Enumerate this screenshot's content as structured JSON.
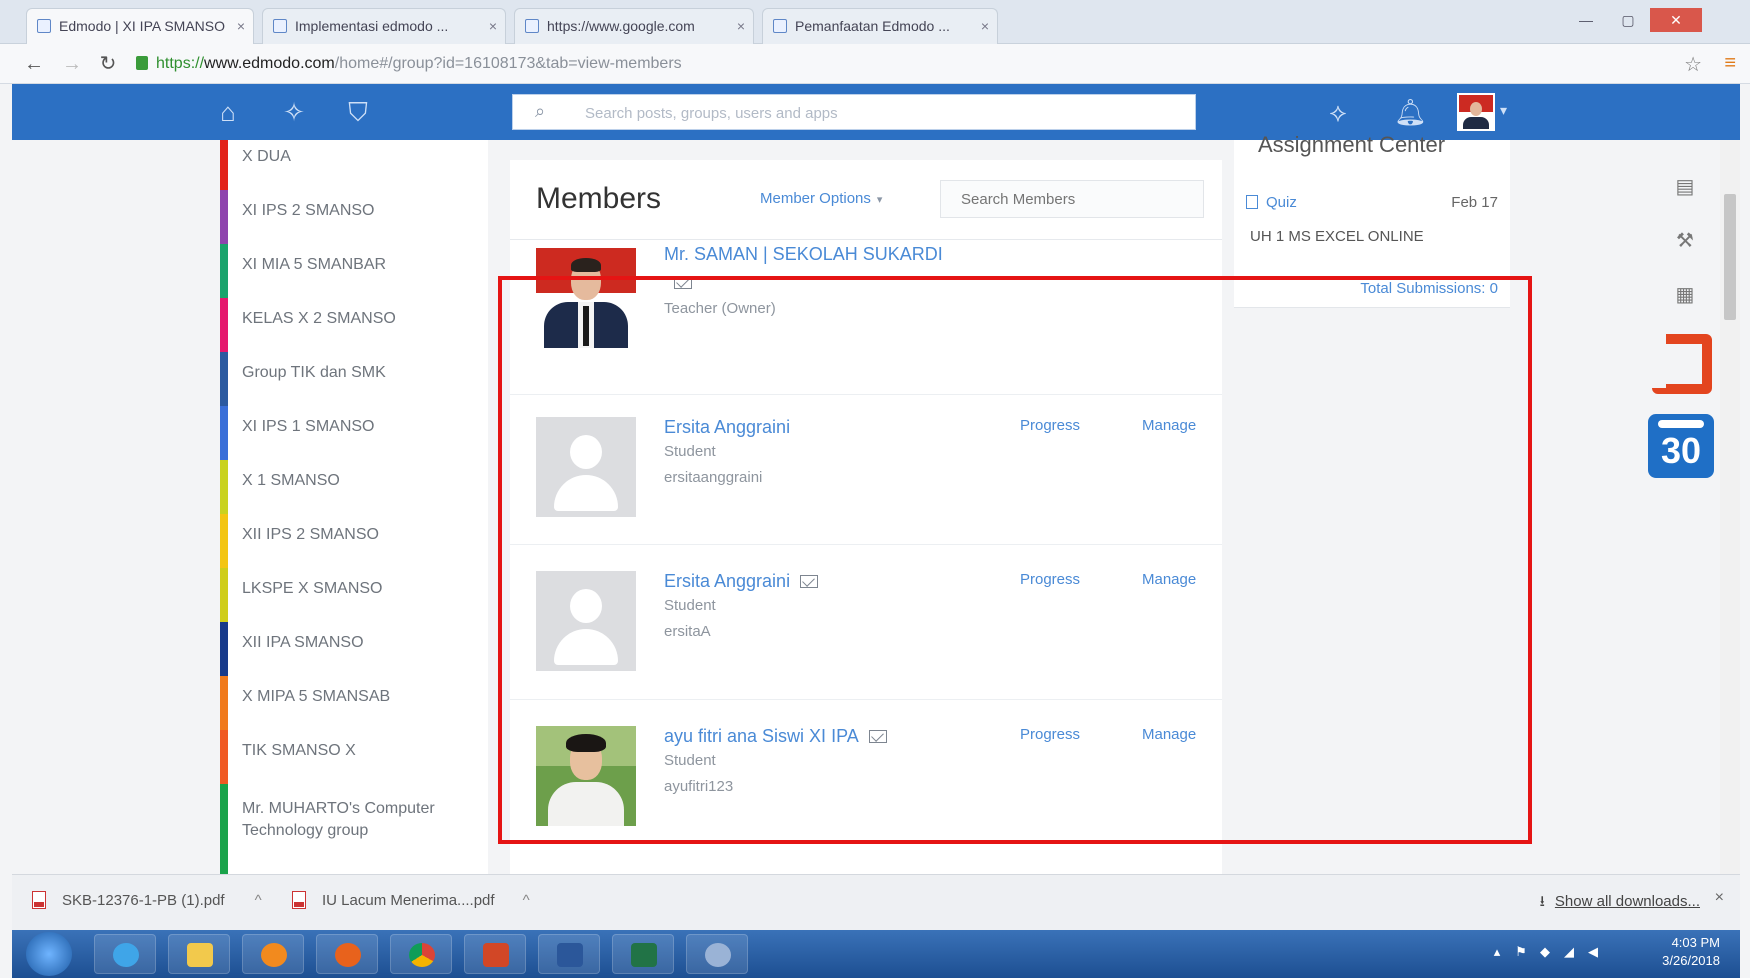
{
  "browser": {
    "tabs": [
      {
        "title": "Edmodo | XI IPA SMANSO",
        "active": true
      },
      {
        "title": "Implementasi edmodo ..."
      },
      {
        "title": "https://www.google.com"
      },
      {
        "title": "Pemanfaatan Edmodo ..."
      }
    ],
    "url": {
      "scheme": "https://",
      "host": "www.edmodo.com",
      "path": "/home#/group?id=16108173&tab=view-members"
    }
  },
  "app": {
    "search_placeholder": "Search posts, groups, users and apps",
    "groups": [
      {
        "label": "X DUA",
        "color": "#e2231a"
      },
      {
        "label": "XI IPS 2 SMANSO",
        "color": "#8e44ad"
      },
      {
        "label": "XI MIA 5 SMANBAR",
        "color": "#1aa36c"
      },
      {
        "label": "KELAS X 2 SMANSO",
        "color": "#e5186d"
      },
      {
        "label": "Group TIK dan SMK",
        "color": "#2c5aa0"
      },
      {
        "label": "XI IPS 1 SMANSO",
        "color": "#3a6fd8"
      },
      {
        "label": "X 1 SMANSO",
        "color": "#c9d21f"
      },
      {
        "label": "XII IPS 2 SMANSO",
        "color": "#f3c512"
      },
      {
        "label": "LKSPE X SMANSO",
        "color": "#cfcd1a"
      },
      {
        "label": "XII IPA SMANSO",
        "color": "#173a8a"
      },
      {
        "label": "X MIPA 5 SMANSAB",
        "color": "#f07a1c"
      },
      {
        "label": "TIK SMANSO X",
        "color": "#f05a24"
      },
      {
        "label": "Mr. MUHARTO's Computer Technology group",
        "color": "#1aa34a"
      }
    ],
    "members_panel": {
      "title": "Members",
      "options_label": "Member Options",
      "filter_placeholder": "Search Members",
      "members": [
        {
          "name": "Mr. SAMAN | SEKOLAH SUKARDI",
          "role": "Teacher (Owner)",
          "username": "",
          "avatar": "teacher",
          "actions": []
        },
        {
          "name": "Ersita Anggraini",
          "role": "Student",
          "username": "ersitaanggraini",
          "avatar": "default",
          "actions": [
            "Progress",
            "Manage"
          ]
        },
        {
          "name": "Ersita Anggraini",
          "role": "Student",
          "username": "ersitaA",
          "avatar": "default",
          "actions": [
            "Progress",
            "Manage"
          ]
        },
        {
          "name": "ayu fitri ana Siswi XI IPA",
          "role": "Student",
          "username": "ayufitri123",
          "avatar": "student",
          "actions": [
            "Progress",
            "Manage"
          ]
        }
      ]
    },
    "assignment_center": {
      "title": "Assignment Center",
      "item_type": "Quiz",
      "item_date": "Feb 17",
      "item_title": "UH 1 MS EXCEL ONLINE",
      "total_label": "Total Submissions: 0"
    },
    "calendar_day": "30"
  },
  "downloads": {
    "files": [
      "SKB-12376-1-PB (1).pdf",
      "IU Lacum Menerima....pdf"
    ],
    "show_all": "Show all downloads..."
  },
  "taskbar": {
    "time": "4:03 PM",
    "date": "3/26/2018"
  },
  "highlight_color": "#e51414"
}
